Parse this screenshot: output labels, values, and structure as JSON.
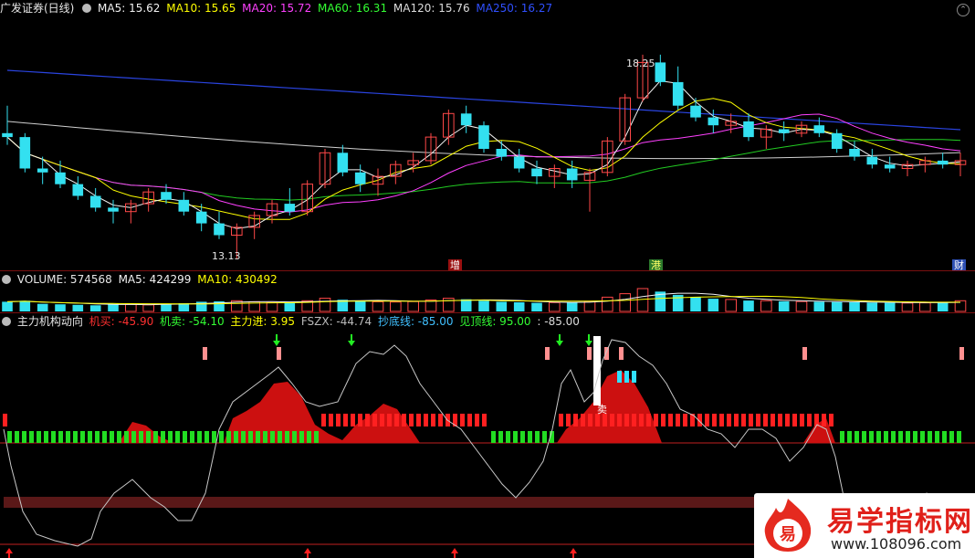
{
  "price_header": {
    "title": "广发证券(日线)",
    "ma": [
      {
        "label": "MA5: 15.62",
        "color": "#f2f2f2"
      },
      {
        "label": "MA10: 15.65",
        "color": "#ffff00"
      },
      {
        "label": "MA20: 15.72",
        "color": "#ff40ff"
      },
      {
        "label": "MA60: 16.31",
        "color": "#33ff33"
      },
      {
        "label": "MA120: 15.76",
        "color": "#dcdcdc"
      },
      {
        "label": "MA250: 16.27",
        "color": "#3050ff"
      }
    ]
  },
  "price_chart": {
    "high_label": "18.25",
    "low_label": "13.13",
    "tags": [
      {
        "text": "增",
        "bg": "#9a1010",
        "color": "#ffffff"
      },
      {
        "text": "港",
        "bg": "#2c7a2c",
        "color": "#ffff66"
      },
      {
        "text": "财",
        "bg": "#2d4fb3",
        "color": "#ffffff"
      }
    ]
  },
  "volume_header": {
    "label": "VOLUME: 574568",
    "ma5": "MA5: 424299",
    "ma10": "MA10: 430492"
  },
  "indicator_header": {
    "title": "主力机构动向",
    "items": [
      {
        "label": "机买: -45.90",
        "color": "#ff3030"
      },
      {
        "label": "机卖: -54.10",
        "color": "#33ff33"
      },
      {
        "label": "主力进: 3.95",
        "color": "#ffff00"
      },
      {
        "label": "FSZX: -44.74",
        "color": "#bbbbbb"
      },
      {
        "label": "抄底线: -85.00",
        "color": "#40c0ff"
      },
      {
        "label": "见顶线: 95.00",
        "color": "#33ff33"
      },
      {
        "label": ": -85.00",
        "color": "#dddddd"
      }
    ],
    "sell_marker": "卖"
  },
  "watermark": {
    "title": "易学指标网",
    "url": "www.108096.com",
    "mark_glyph": "易"
  },
  "chart_data": {
    "type": "candlestick",
    "ylim": [
      13.13,
      18.25
    ],
    "candles": [
      [
        16.3,
        17.0,
        16.0,
        16.2
      ],
      [
        16.2,
        16.3,
        15.3,
        15.4
      ],
      [
        15.4,
        15.7,
        15.0,
        15.3
      ],
      [
        15.3,
        15.6,
        14.9,
        15.0
      ],
      [
        15.0,
        15.2,
        14.6,
        14.7
      ],
      [
        14.7,
        14.9,
        14.3,
        14.4
      ],
      [
        14.4,
        14.6,
        14.0,
        14.3
      ],
      [
        14.3,
        14.6,
        14.0,
        14.5
      ],
      [
        14.5,
        14.9,
        14.3,
        14.8
      ],
      [
        14.8,
        15.0,
        14.5,
        14.6
      ],
      [
        14.6,
        14.8,
        14.2,
        14.3
      ],
      [
        14.3,
        14.5,
        13.8,
        14.0
      ],
      [
        14.0,
        14.3,
        13.6,
        13.7
      ],
      [
        13.7,
        14.0,
        13.1,
        13.9
      ],
      [
        13.9,
        14.3,
        13.6,
        14.2
      ],
      [
        14.2,
        14.6,
        14.0,
        14.5
      ],
      [
        14.5,
        14.9,
        14.2,
        14.3
      ],
      [
        14.3,
        15.1,
        14.2,
        15.0
      ],
      [
        15.0,
        15.9,
        14.9,
        15.8
      ],
      [
        15.8,
        16.0,
        15.2,
        15.3
      ],
      [
        15.3,
        15.5,
        14.8,
        15.0
      ],
      [
        15.0,
        15.4,
        14.7,
        15.2
      ],
      [
        15.2,
        15.6,
        15.0,
        15.5
      ],
      [
        15.5,
        15.8,
        15.3,
        15.6
      ],
      [
        15.6,
        16.3,
        15.5,
        16.2
      ],
      [
        16.2,
        16.9,
        16.0,
        16.8
      ],
      [
        16.8,
        17.0,
        16.3,
        16.5
      ],
      [
        16.5,
        16.6,
        15.8,
        15.9
      ],
      [
        15.9,
        16.1,
        15.6,
        15.7
      ],
      [
        15.7,
        15.9,
        15.3,
        15.4
      ],
      [
        15.4,
        15.6,
        15.0,
        15.2
      ],
      [
        15.2,
        15.5,
        14.9,
        15.4
      ],
      [
        15.4,
        15.6,
        14.9,
        15.1
      ],
      [
        15.1,
        15.4,
        14.3,
        15.3
      ],
      [
        15.3,
        16.2,
        15.2,
        16.1
      ],
      [
        16.1,
        17.3,
        16.0,
        17.2
      ],
      [
        17.2,
        18.3,
        17.1,
        18.1
      ],
      [
        18.1,
        18.3,
        17.5,
        17.6
      ],
      [
        17.6,
        18.0,
        16.9,
        17.0
      ],
      [
        17.0,
        17.2,
        16.6,
        16.7
      ],
      [
        16.7,
        16.9,
        16.3,
        16.5
      ],
      [
        16.5,
        16.8,
        16.3,
        16.6
      ],
      [
        16.6,
        16.8,
        16.1,
        16.2
      ],
      [
        16.2,
        16.5,
        15.9,
        16.4
      ],
      [
        16.4,
        16.6,
        16.1,
        16.3
      ],
      [
        16.3,
        16.6,
        16.2,
        16.5
      ],
      [
        16.5,
        16.7,
        16.2,
        16.3
      ],
      [
        16.3,
        16.4,
        15.8,
        15.9
      ],
      [
        15.9,
        16.1,
        15.6,
        15.7
      ],
      [
        15.7,
        15.9,
        15.4,
        15.5
      ],
      [
        15.5,
        15.7,
        15.3,
        15.4
      ],
      [
        15.4,
        15.6,
        15.2,
        15.5
      ],
      [
        15.5,
        15.7,
        15.3,
        15.6
      ],
      [
        15.6,
        15.8,
        15.4,
        15.5
      ],
      [
        15.5,
        15.8,
        15.2,
        15.6
      ]
    ],
    "volume": [
      380,
      420,
      300,
      280,
      260,
      240,
      300,
      280,
      260,
      300,
      320,
      380,
      400,
      420,
      380,
      350,
      330,
      420,
      520,
      460,
      400,
      380,
      370,
      390,
      450,
      520,
      480,
      420,
      380,
      360,
      340,
      350,
      360,
      400,
      560,
      700,
      900,
      780,
      650,
      560,
      500,
      470,
      430,
      420,
      400,
      390,
      380,
      370,
      360,
      350,
      340,
      330,
      340,
      360,
      420
    ]
  }
}
